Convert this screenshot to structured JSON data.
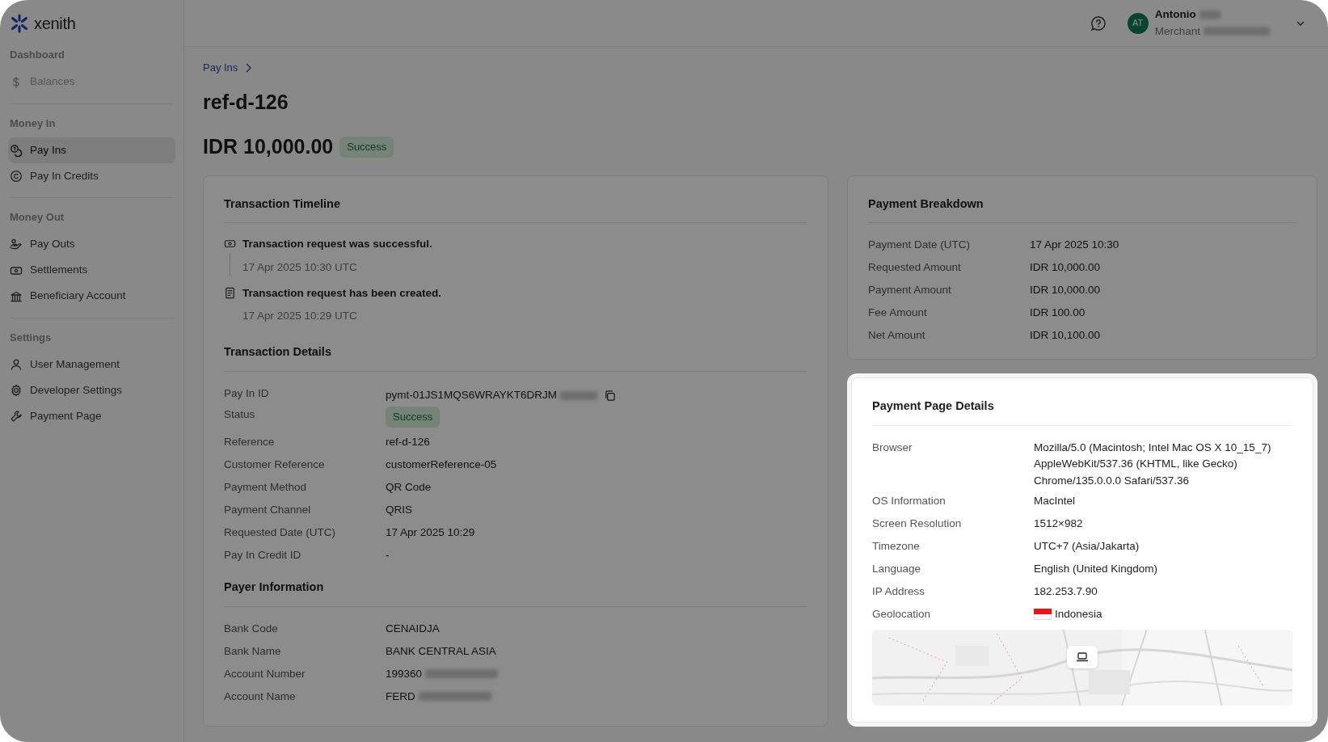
{
  "brand": {
    "name": "xenith"
  },
  "sidebar": {
    "sections": [
      {
        "title": "Dashboard",
        "items": [
          {
            "label": "Balances",
            "selected": false,
            "disabled": true
          }
        ]
      },
      {
        "title": "Money In",
        "items": [
          {
            "label": "Pay Ins",
            "selected": true,
            "disabled": false
          },
          {
            "label": "Pay In Credits",
            "selected": false,
            "disabled": false
          }
        ]
      },
      {
        "title": "Money Out",
        "items": [
          {
            "label": "Pay Outs",
            "selected": false,
            "disabled": false
          },
          {
            "label": "Settlements",
            "selected": false,
            "disabled": false
          },
          {
            "label": "Beneficiary Account",
            "selected": false,
            "disabled": false
          }
        ]
      },
      {
        "title": "Settings",
        "items": [
          {
            "label": "User Management",
            "selected": false,
            "disabled": false
          },
          {
            "label": "Developer Settings",
            "selected": false,
            "disabled": false
          },
          {
            "label": "Payment Page",
            "selected": false,
            "disabled": false
          }
        ]
      }
    ]
  },
  "header": {
    "user": {
      "initials": "AT",
      "name": "Antonio",
      "role": "Merchant",
      "redacted": true
    }
  },
  "breadcrumb": [
    {
      "label": "Pay Ins"
    }
  ],
  "title": "ref-d-126",
  "amount": "IDR 10,000.00",
  "status": "Success",
  "timeline": {
    "title": "Transaction Timeline",
    "events": [
      {
        "text": "Transaction request was successful.",
        "time": "17 Apr 2025 10:30 UTC"
      },
      {
        "text": "Transaction request has been created.",
        "time": "17 Apr 2025 10:29 UTC"
      }
    ]
  },
  "transaction_details": {
    "title": "Transaction Details",
    "rows": [
      {
        "label": "Pay In ID",
        "value": "pymt-01JS1MQS6WRAYKT6DRJM",
        "kind": "copy",
        "redacted": true
      },
      {
        "label": "Status",
        "value": "Success",
        "kind": "badge",
        "redacted": false
      },
      {
        "label": "Reference",
        "value": "ref-d-126",
        "kind": "text",
        "redacted": false
      },
      {
        "label": "Customer Reference",
        "value": "customerReference-05",
        "kind": "text",
        "redacted": false
      },
      {
        "label": "Payment Method",
        "value": "QR Code",
        "kind": "text",
        "redacted": false
      },
      {
        "label": "Payment Channel",
        "value": "QRIS",
        "kind": "text",
        "redacted": false
      },
      {
        "label": "Requested Date (UTC)",
        "value": "17 Apr 2025 10:29",
        "kind": "text",
        "redacted": false
      },
      {
        "label": "Pay In Credit ID",
        "value": "-",
        "kind": "text",
        "redacted": false
      }
    ]
  },
  "payer_information": {
    "title": "Payer Information",
    "rows": [
      {
        "label": "Bank Code",
        "value": "CENAIDJA",
        "redacted": false
      },
      {
        "label": "Bank Name",
        "value": "BANK CENTRAL ASIA",
        "redacted": false
      },
      {
        "label": "Account Number",
        "value": "199360",
        "redacted": true
      },
      {
        "label": "Account Name",
        "value": "FERD",
        "redacted": true
      }
    ]
  },
  "payment_breakdown": {
    "title": "Payment Breakdown",
    "rows": [
      {
        "label": "Payment Date (UTC)",
        "value": "17 Apr 2025 10:30"
      },
      {
        "label": "Requested Amount",
        "value": "IDR 10,000.00"
      },
      {
        "label": "Payment Amount",
        "value": "IDR 10,000.00"
      },
      {
        "label": "Fee Amount",
        "value": "IDR 100.00"
      },
      {
        "label": "Net Amount",
        "value": "IDR 10,100.00"
      }
    ]
  },
  "payment_page_details": {
    "title": "Payment Page Details",
    "highlighted": true,
    "rows": [
      {
        "label": "Browser",
        "value": "Mozilla/5.0 (Macintosh; Intel Mac OS X 10_15_7) AppleWebKit/537.36 (KHTML, like Gecko) Chrome/135.0.0.0 Safari/537.36",
        "kind": "text"
      },
      {
        "label": "OS Information",
        "value": "MacIntel",
        "kind": "text"
      },
      {
        "label": "Screen Resolution",
        "value": "1512×982",
        "kind": "text"
      },
      {
        "label": "Timezone",
        "value": "UTC+7 (Asia/Jakarta)",
        "kind": "text"
      },
      {
        "label": "Language",
        "value": "English (United Kingdom)",
        "kind": "text"
      },
      {
        "label": "IP Address",
        "value": "182.253.7.90",
        "kind": "text"
      },
      {
        "label": "Geolocation",
        "value": "Indonesia",
        "kind": "country"
      }
    ]
  }
}
